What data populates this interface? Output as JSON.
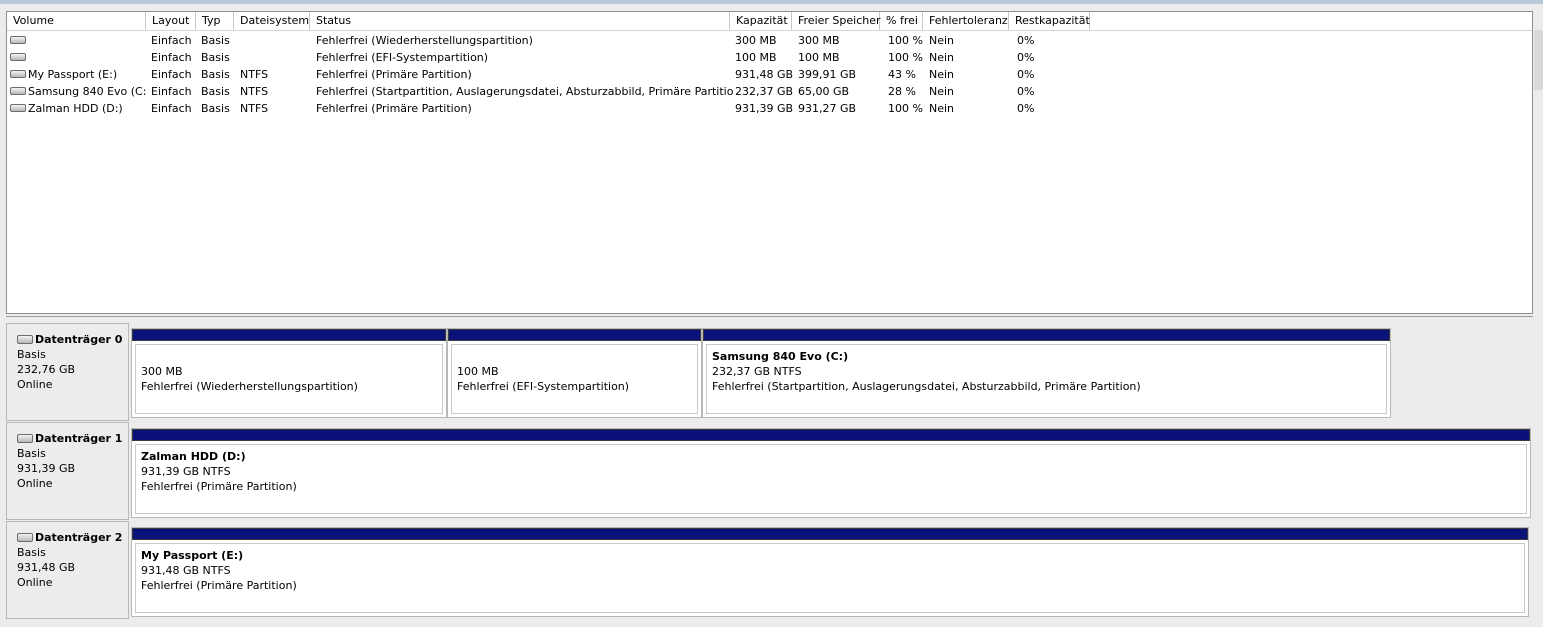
{
  "columns": [
    "Volume",
    "Layout",
    "Typ",
    "Dateisystem",
    "Status",
    "Kapazität",
    "Freier Speicher",
    "% frei",
    "Fehlertoleranz",
    "Restkapazität"
  ],
  "volumes": [
    {
      "volume": "",
      "layout": "Einfach",
      "typ": "Basis",
      "fs": "",
      "status": "Fehlerfrei (Wiederherstellungspartition)",
      "kap": "300 MB",
      "frei": "300 MB",
      "pct": "100 %",
      "ft": "Nein",
      "rest": "0%"
    },
    {
      "volume": "",
      "layout": "Einfach",
      "typ": "Basis",
      "fs": "",
      "status": "Fehlerfrei (EFI-Systempartition)",
      "kap": "100 MB",
      "frei": "100 MB",
      "pct": "100 %",
      "ft": "Nein",
      "rest": "0%"
    },
    {
      "volume": "My Passport (E:)",
      "layout": "Einfach",
      "typ": "Basis",
      "fs": "NTFS",
      "status": "Fehlerfrei (Primäre Partition)",
      "kap": "931,48 GB",
      "frei": "399,91 GB",
      "pct": "43 %",
      "ft": "Nein",
      "rest": "0%"
    },
    {
      "volume": "Samsung 840 Evo (C:)",
      "layout": "Einfach",
      "typ": "Basis",
      "fs": "NTFS",
      "status": "Fehlerfrei (Startpartition, Auslagerungsdatei, Absturzabbild, Primäre Partition)",
      "kap": "232,37 GB",
      "frei": "65,00 GB",
      "pct": "28 %",
      "ft": "Nein",
      "rest": "0%"
    },
    {
      "volume": "Zalman HDD (D:)",
      "layout": "Einfach",
      "typ": "Basis",
      "fs": "NTFS",
      "status": "Fehlerfrei (Primäre Partition)",
      "kap": "931,39 GB",
      "frei": "931,27 GB",
      "pct": "100 %",
      "ft": "Nein",
      "rest": "0%"
    }
  ],
  "disks": [
    {
      "name": "Datenträger 0",
      "type": "Basis",
      "size": "232,76 GB",
      "state": "Online",
      "partitions": [
        {
          "title": "",
          "size": "300 MB",
          "status": "Fehlerfrei (Wiederherstellungspartition)"
        },
        {
          "title": "",
          "size": "100 MB",
          "status": "Fehlerfrei (EFI-Systempartition)"
        },
        {
          "title": "Samsung 840 Evo  (C:)",
          "size": "232,37 GB NTFS",
          "status": "Fehlerfrei (Startpartition, Auslagerungsdatei, Absturzabbild, Primäre Partition)"
        }
      ]
    },
    {
      "name": "Datenträger 1",
      "type": "Basis",
      "size": "931,39 GB",
      "state": "Online",
      "partitions": [
        {
          "title": "Zalman HDD  (D:)",
          "size": "931,39 GB NTFS",
          "status": "Fehlerfrei (Primäre Partition)"
        }
      ]
    },
    {
      "name": "Datenträger 2",
      "type": "Basis",
      "size": "931,48 GB",
      "state": "Online",
      "partitions": [
        {
          "title": "My Passport  (E:)",
          "size": "931,48 GB NTFS",
          "status": "Fehlerfrei (Primäre Partition)"
        }
      ]
    }
  ],
  "colors": {
    "partition_bar": "#0a127a",
    "background": "#ececec"
  },
  "icons": {
    "volume": "drive-icon",
    "disk": "disk-icon"
  }
}
